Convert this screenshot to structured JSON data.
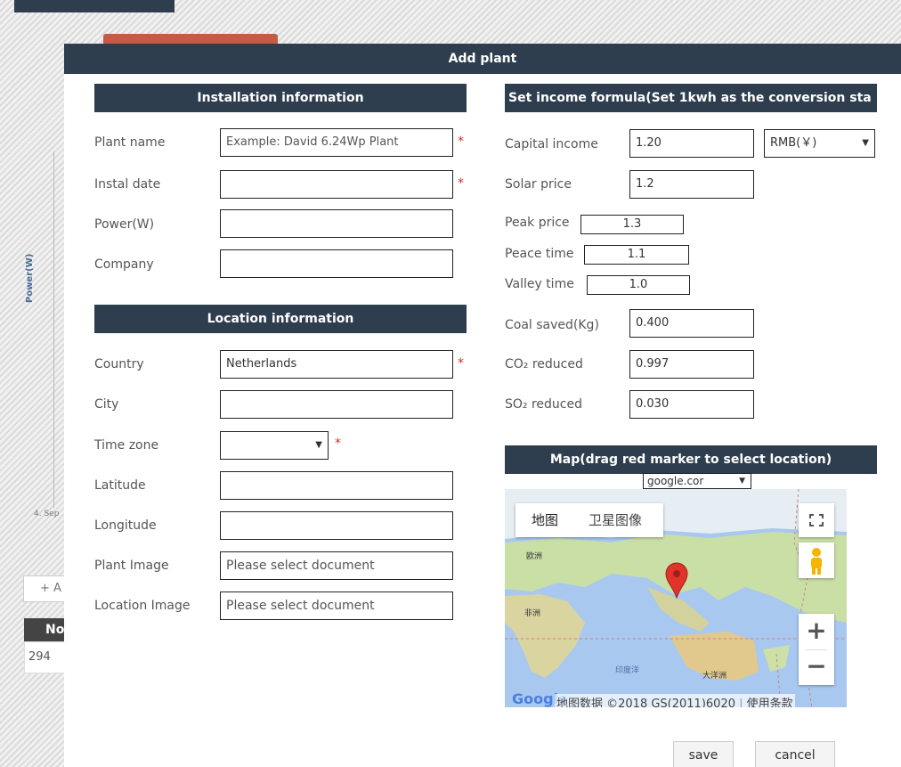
{
  "background": {
    "ylabel": "Power(W)",
    "xtick": "4. Sep",
    "add_button": "+ A",
    "table_header": "No",
    "table_cell": "294"
  },
  "modal": {
    "title": "Add plant",
    "install": {
      "header": "Installation information",
      "plant_name_label": "Plant name",
      "plant_name_placeholder": "Example: David 6.24Wp Plant",
      "instal_date_label": "Instal date",
      "instal_date_value": "",
      "power_label": "Power(W)",
      "power_value": "",
      "company_label": "Company",
      "company_value": ""
    },
    "location": {
      "header": "Location information",
      "country_label": "Country",
      "country_value": "Netherlands",
      "city_label": "City",
      "city_value": "",
      "timezone_label": "Time zone",
      "timezone_value": "",
      "latitude_label": "Latitude",
      "latitude_value": "",
      "longitude_label": "Longitude",
      "longitude_value": "",
      "plant_image_label": "Plant Image",
      "plant_image_placeholder": "Please select document",
      "location_image_label": "Location Image",
      "location_image_placeholder": "Please select document"
    },
    "income": {
      "header": "Set income formula(Set 1kwh as the conversion sta",
      "capital_income_label": "Capital income",
      "capital_income_value": "1.20",
      "currency": "RMB(￥)",
      "solar_price_label": "Solar price",
      "solar_price_value": "1.2",
      "peak_price_label": "Peak price",
      "peak_price_value": "1.3",
      "peace_time_label": "Peace time",
      "peace_time_value": "1.1",
      "valley_time_label": "Valley time",
      "valley_time_value": "1.0",
      "coal_label": "Coal saved(Kg)",
      "coal_value": "0.400",
      "co2_label": "CO₂ reduced",
      "co2_value": "0.997",
      "so2_label": "SO₂ reduced",
      "so2_value": "0.030"
    },
    "map": {
      "header": "Map(drag red marker to select location)",
      "provider": "google.cor",
      "type_map": "地图",
      "type_satellite": "卫星图像",
      "label_europe": "欧洲",
      "label_africa": "非洲",
      "label_indian_ocean": "印度洋",
      "label_oceania": "大洋洲",
      "google_logo": "Google",
      "attribution": "地图数据 ©2018 GS(2011)6020",
      "terms": "使用条款",
      "zoom_in": "+",
      "zoom_out": "−"
    },
    "actions": {
      "save": "save",
      "cancel": "cancel"
    },
    "colors": {
      "header_bg": "#2f3e4e",
      "required": "#d9302c",
      "marker": "#e0342a"
    }
  }
}
